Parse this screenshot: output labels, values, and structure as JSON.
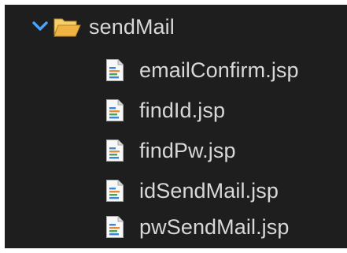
{
  "folder": {
    "name": "sendMail",
    "expanded": true,
    "icon": "open-folder-icon",
    "chevron_icon": "chevron-down-icon",
    "chevron_color": "#4aa3ff",
    "folder_color": "#f2b84b"
  },
  "files": [
    {
      "name": "emailConfirm.jsp",
      "icon": "jsp-file-icon"
    },
    {
      "name": "findId.jsp",
      "icon": "jsp-file-icon"
    },
    {
      "name": "findPw.jsp",
      "icon": "jsp-file-icon"
    },
    {
      "name": "idSendMail.jsp",
      "icon": "jsp-file-icon"
    },
    {
      "name": "pwSendMail.jsp",
      "icon": "jsp-file-icon"
    }
  ],
  "colors": {
    "background": "#1e1e1e",
    "text": "#d8d8d8"
  }
}
